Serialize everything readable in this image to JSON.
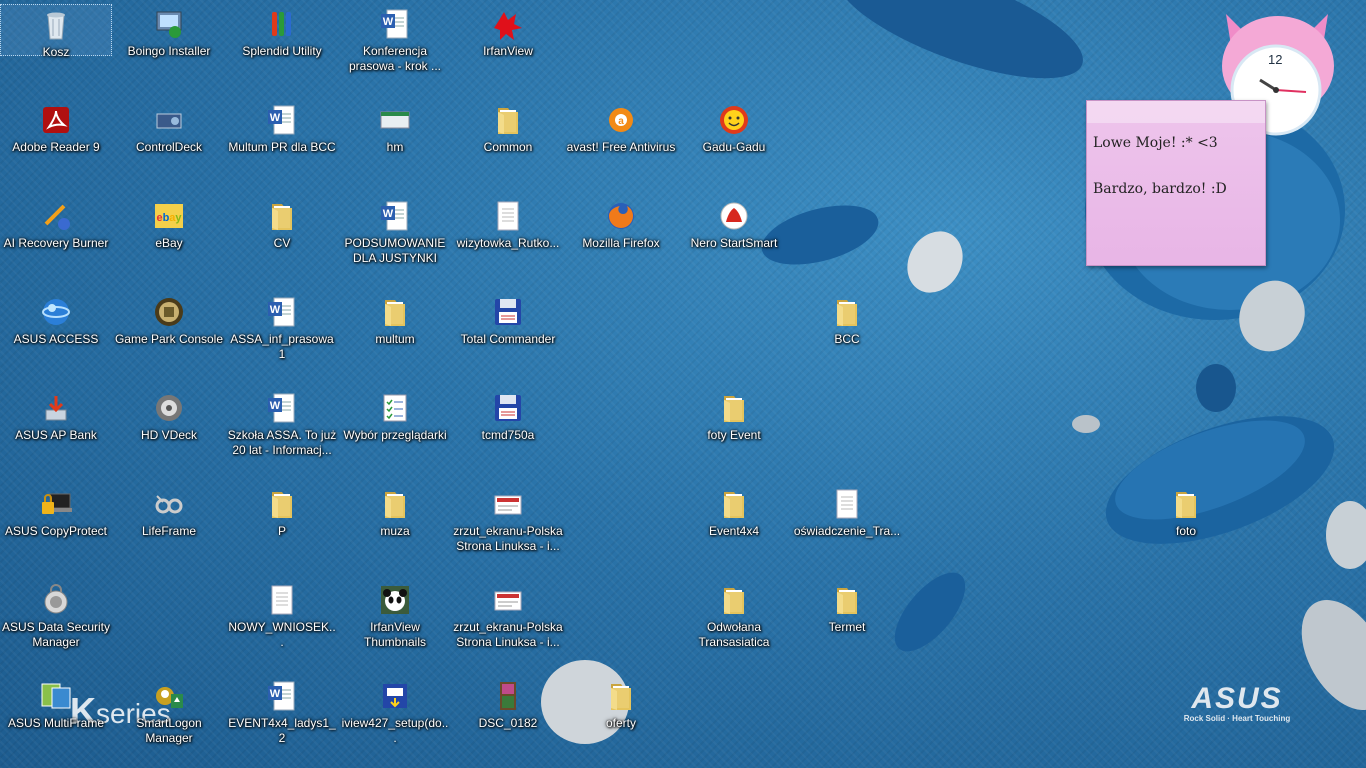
{
  "desktop": {
    "icons": [
      {
        "label": "Kosz",
        "icon": "recycle-bin-icon"
      },
      {
        "label": "Boingo Installer",
        "icon": "installer-icon"
      },
      {
        "label": "Splendid Utility",
        "icon": "splendid-utility-icon"
      },
      {
        "label": "Konferencja prasowa - krok ...",
        "icon": "word-document-icon"
      },
      {
        "label": "IrfanView",
        "icon": "irfanview-icon"
      },
      {
        "label": "Adobe Reader 9",
        "icon": "adobe-reader-icon"
      },
      {
        "label": "ControlDeck",
        "icon": "controldeck-icon"
      },
      {
        "label": "Multum PR dla BCC",
        "icon": "word-document-icon"
      },
      {
        "label": "hm",
        "icon": "window-shortcut-icon"
      },
      {
        "label": "Common",
        "icon": "folder-icon"
      },
      {
        "label": "avast! Free Antivirus",
        "icon": "avast-icon"
      },
      {
        "label": "Gadu-Gadu",
        "icon": "gadu-gadu-icon"
      },
      {
        "label": "AI Recovery Burner",
        "icon": "recovery-burner-icon"
      },
      {
        "label": "eBay",
        "icon": "ebay-icon"
      },
      {
        "label": "CV",
        "icon": "folder-icon"
      },
      {
        "label": "PODSUMOWANIE DLA JUSTYNKI",
        "icon": "word-document-icon"
      },
      {
        "label": "wizytowka_Rutko...",
        "icon": "document-icon"
      },
      {
        "label": "Mozilla Firefox",
        "icon": "firefox-icon"
      },
      {
        "label": "Nero StartSmart",
        "icon": "nero-icon"
      },
      {
        "label": "ASUS ACCESS",
        "icon": "asus-access-icon"
      },
      {
        "label": "Game Park Console",
        "icon": "game-park-icon"
      },
      {
        "label": "ASSA_inf_prasowa1",
        "icon": "word-document-icon"
      },
      {
        "label": "multum",
        "icon": "folder-icon"
      },
      {
        "label": "Total Commander",
        "icon": "floppy-disk-icon"
      },
      {
        "label": "BCC",
        "icon": "folder-icon"
      },
      {
        "label": "ASUS AP Bank",
        "icon": "ap-bank-icon"
      },
      {
        "label": "HD VDeck",
        "icon": "hd-vdeck-icon"
      },
      {
        "label": "Szkoła ASSA. To już 20 lat - Informacj...",
        "icon": "word-document-icon"
      },
      {
        "label": "Wybór przeglądarki",
        "icon": "checklist-icon"
      },
      {
        "label": "tcmd750a",
        "icon": "floppy-disk-icon"
      },
      {
        "label": "foty Event",
        "icon": "folder-icon"
      },
      {
        "label": "ASUS CopyProtect",
        "icon": "lock-laptop-icon"
      },
      {
        "label": "LifeFrame",
        "icon": "lifeframe-icon"
      },
      {
        "label": "P",
        "icon": "folder-icon"
      },
      {
        "label": "muza",
        "icon": "folder-icon"
      },
      {
        "label": "zrzut_ekranu-Polska Strona Linuksa - i...",
        "icon": "image-file-icon"
      },
      {
        "label": "Event4x4",
        "icon": "folder-icon"
      },
      {
        "label": "oświadczenie_Tra...",
        "icon": "text-file-icon"
      },
      {
        "label": "foto",
        "icon": "folder-icon"
      },
      {
        "label": "ASUS Data Security Manager",
        "icon": "data-security-icon"
      },
      {
        "label": "NOWY_WNIOSEK...",
        "icon": "document-icon"
      },
      {
        "label": "IrfanView Thumbnails",
        "icon": "panda-icon"
      },
      {
        "label": "zrzut_ekranu-Polska Strona Linuksa - i...",
        "icon": "image-file-icon"
      },
      {
        "label": "Odwołana Transasiatica",
        "icon": "folder-icon"
      },
      {
        "label": "Termet",
        "icon": "folder-icon"
      },
      {
        "label": "ASUS MultiFrame",
        "icon": "multiframe-icon"
      },
      {
        "label": "SmartLogon Manager",
        "icon": "smartlogon-icon"
      },
      {
        "label": "EVENT4x4_ladys1_2",
        "icon": "word-document-icon"
      },
      {
        "label": "iview427_setup(do...",
        "icon": "setup-icon"
      },
      {
        "label": "DSC_0182",
        "icon": "photo-icon"
      },
      {
        "label": "oferty",
        "icon": "folder-icon"
      }
    ]
  },
  "sticky_note": {
    "line1": "Lowe Moje! :* <3",
    "line2": "Bardzo, bardzo! :D"
  },
  "clock_gadget": {
    "hour_mark": "12"
  },
  "wallpaper": {
    "brand": "ASUS",
    "tagline": "Rock Solid · Heart Touching",
    "series_k": "K",
    "series_text": "series"
  },
  "colors": {
    "folder": "#e8c860",
    "word_blue": "#2b5fb0",
    "sticky": "#eec5ec"
  }
}
